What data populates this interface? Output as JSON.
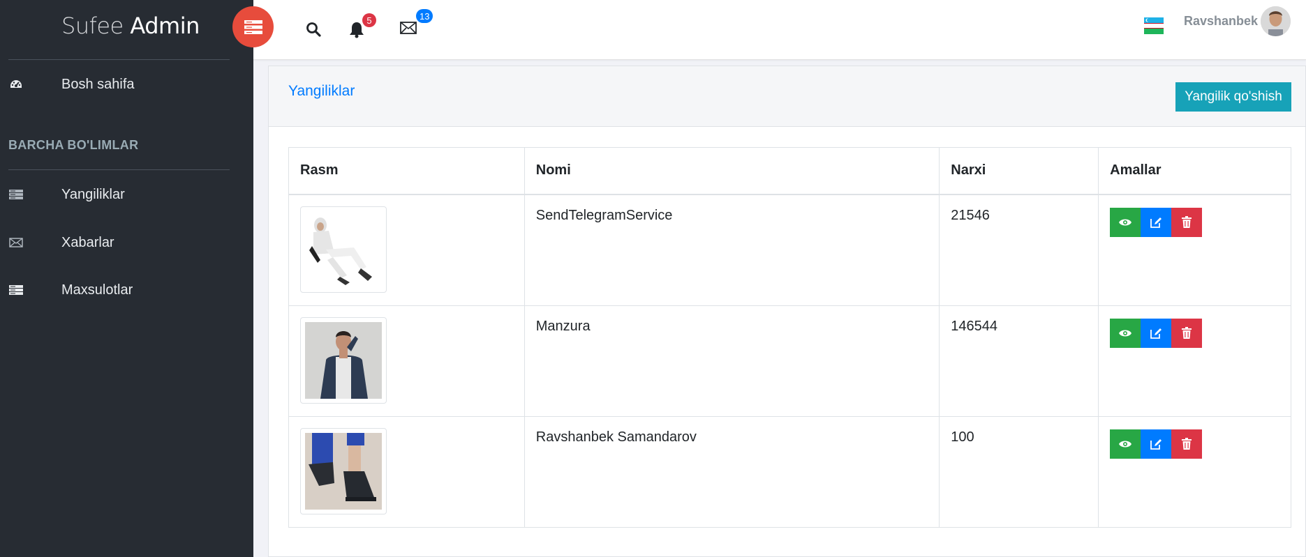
{
  "brand": {
    "light": "Sufee",
    "bold": "Admin"
  },
  "sidebar": {
    "home_label": "Bosh sahifa",
    "section_title": "BARCHA BO'LIMLAR",
    "items": [
      {
        "label": "Yangiliklar",
        "icon": "server-icon"
      },
      {
        "label": "Xabarlar",
        "icon": "envelope-icon"
      },
      {
        "label": "Maxsulotlar",
        "icon": "server-icon"
      }
    ]
  },
  "header": {
    "notifications_count": "5",
    "messages_count": "13",
    "username": "Ravshanbek"
  },
  "card": {
    "title": "Yangiliklar",
    "add_button": "Yangilik qo'shish"
  },
  "table": {
    "headers": [
      "Rasm",
      "Nomi",
      "Narxi",
      "Amallar"
    ],
    "rows": [
      {
        "name": "SendTelegramService",
        "price": "21546"
      },
      {
        "name": "Manzura",
        "price": "146544"
      },
      {
        "name": "Ravshanbek Samandarov",
        "price": "100"
      }
    ]
  },
  "colors": {
    "sidebar_bg": "#272c33",
    "toggle_red": "#e74c3c",
    "primary": "#007bff",
    "info": "#17a2b8",
    "success": "#28a745",
    "danger": "#dc3545"
  }
}
